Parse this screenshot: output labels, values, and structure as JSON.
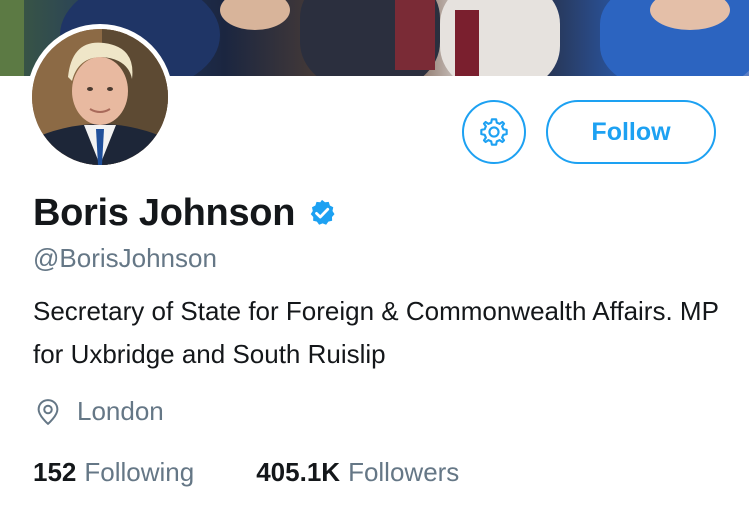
{
  "profile": {
    "name": "Boris Johnson",
    "handle": "@BorisJohnson",
    "bio": "Secretary of State for Foreign & Commonwealth Affairs. MP for Uxbridge and South Ruislip",
    "location": "London",
    "verified": true
  },
  "actions": {
    "follow_label": "Follow",
    "settings_icon": "gear-icon"
  },
  "stats": {
    "following_count": "152",
    "following_label": "Following",
    "followers_count": "405.1K",
    "followers_label": "Followers"
  },
  "colors": {
    "accent": "#1da1f2",
    "text_primary": "#14171a",
    "text_secondary": "#657786"
  }
}
